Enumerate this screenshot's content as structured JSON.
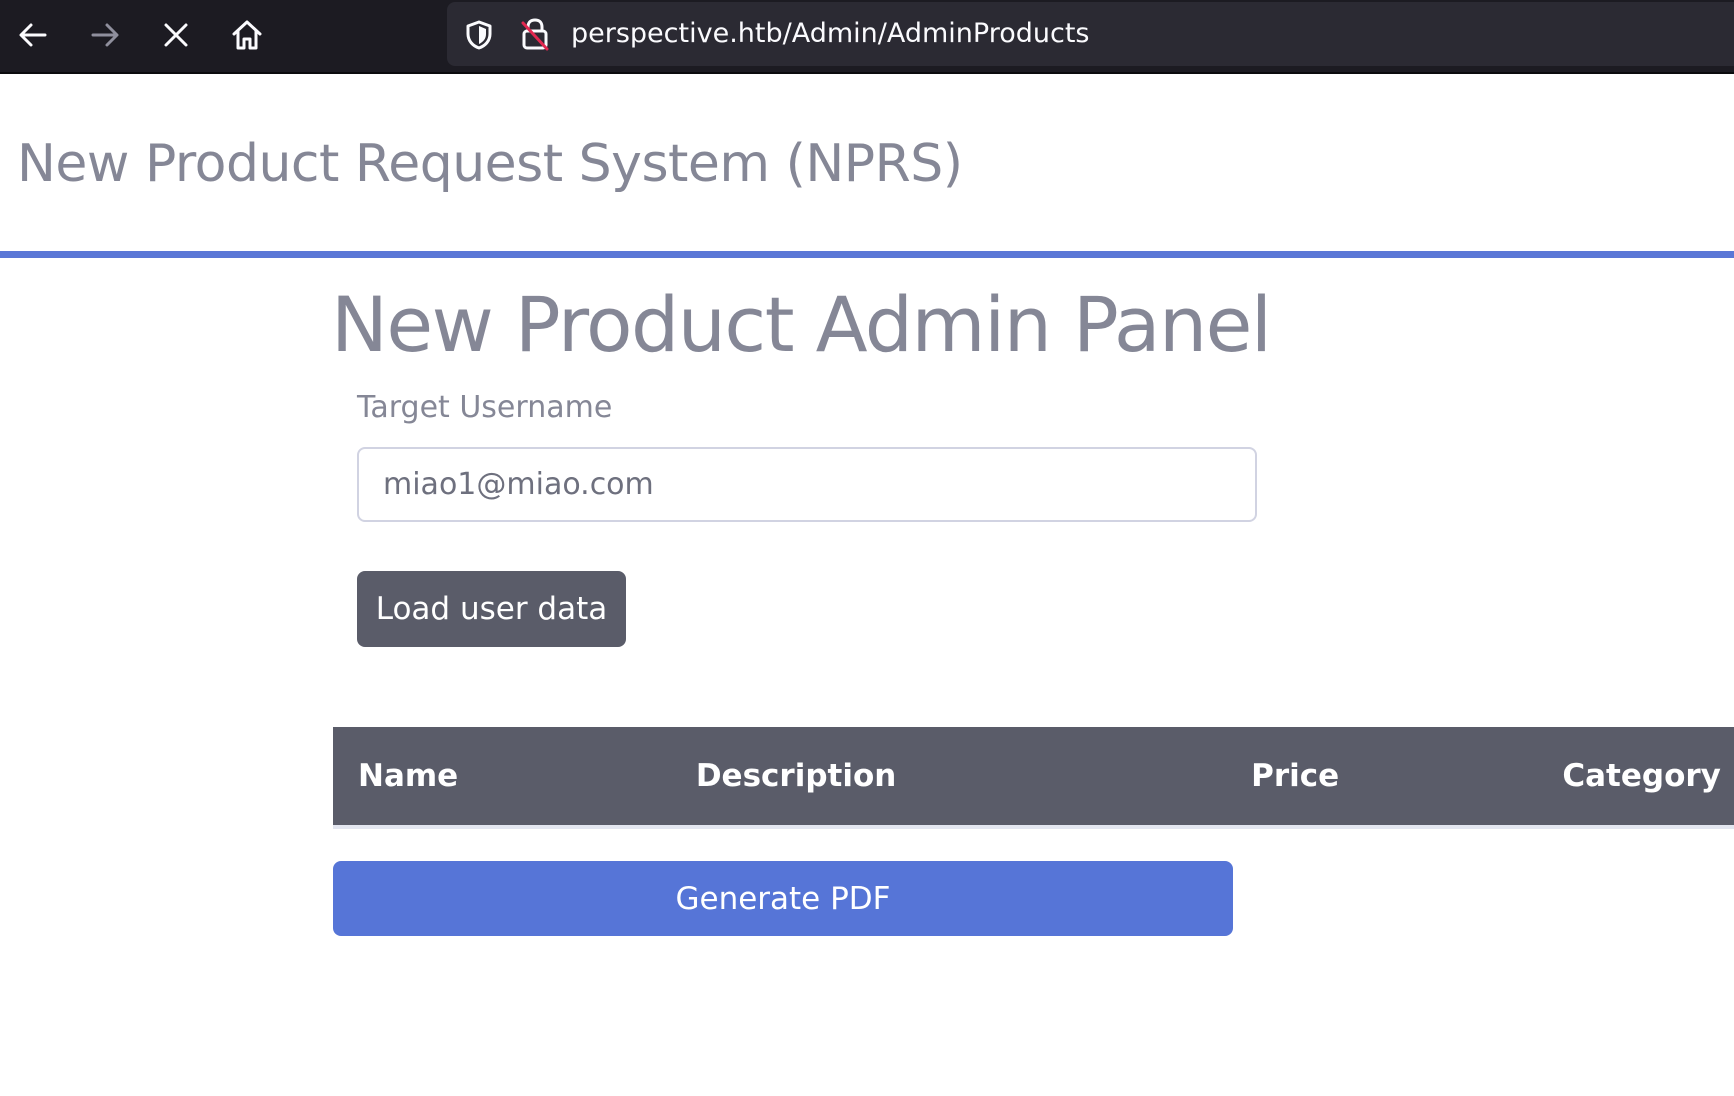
{
  "browser": {
    "url": "perspective.htb/Admin/AdminProducts",
    "icons": {
      "back": "back-arrow-icon",
      "forward": "forward-arrow-icon",
      "stop": "stop-loading-icon",
      "home": "home-icon",
      "tracking": "shield-icon",
      "security": "insecure-lock-icon"
    }
  },
  "header": {
    "site_title": "New Product Request System (NPRS)",
    "accent_color": "#5a77d6"
  },
  "main": {
    "panel_title": "New Product Admin Panel",
    "target_username_label": "Target Username",
    "target_username_value": "miao1@miao.com",
    "load_button_label": "Load user data",
    "table": {
      "columns": [
        "Name",
        "Description",
        "Price",
        "Category"
      ],
      "rows": []
    },
    "generate_pdf_label": "Generate PDF"
  },
  "colors": {
    "text_muted": "#858796",
    "dark_button": "#5a5c69",
    "primary_button": "#5675d7",
    "toolbar_bg": "#1c1b22",
    "urlbar_bg": "#2b2a33"
  }
}
